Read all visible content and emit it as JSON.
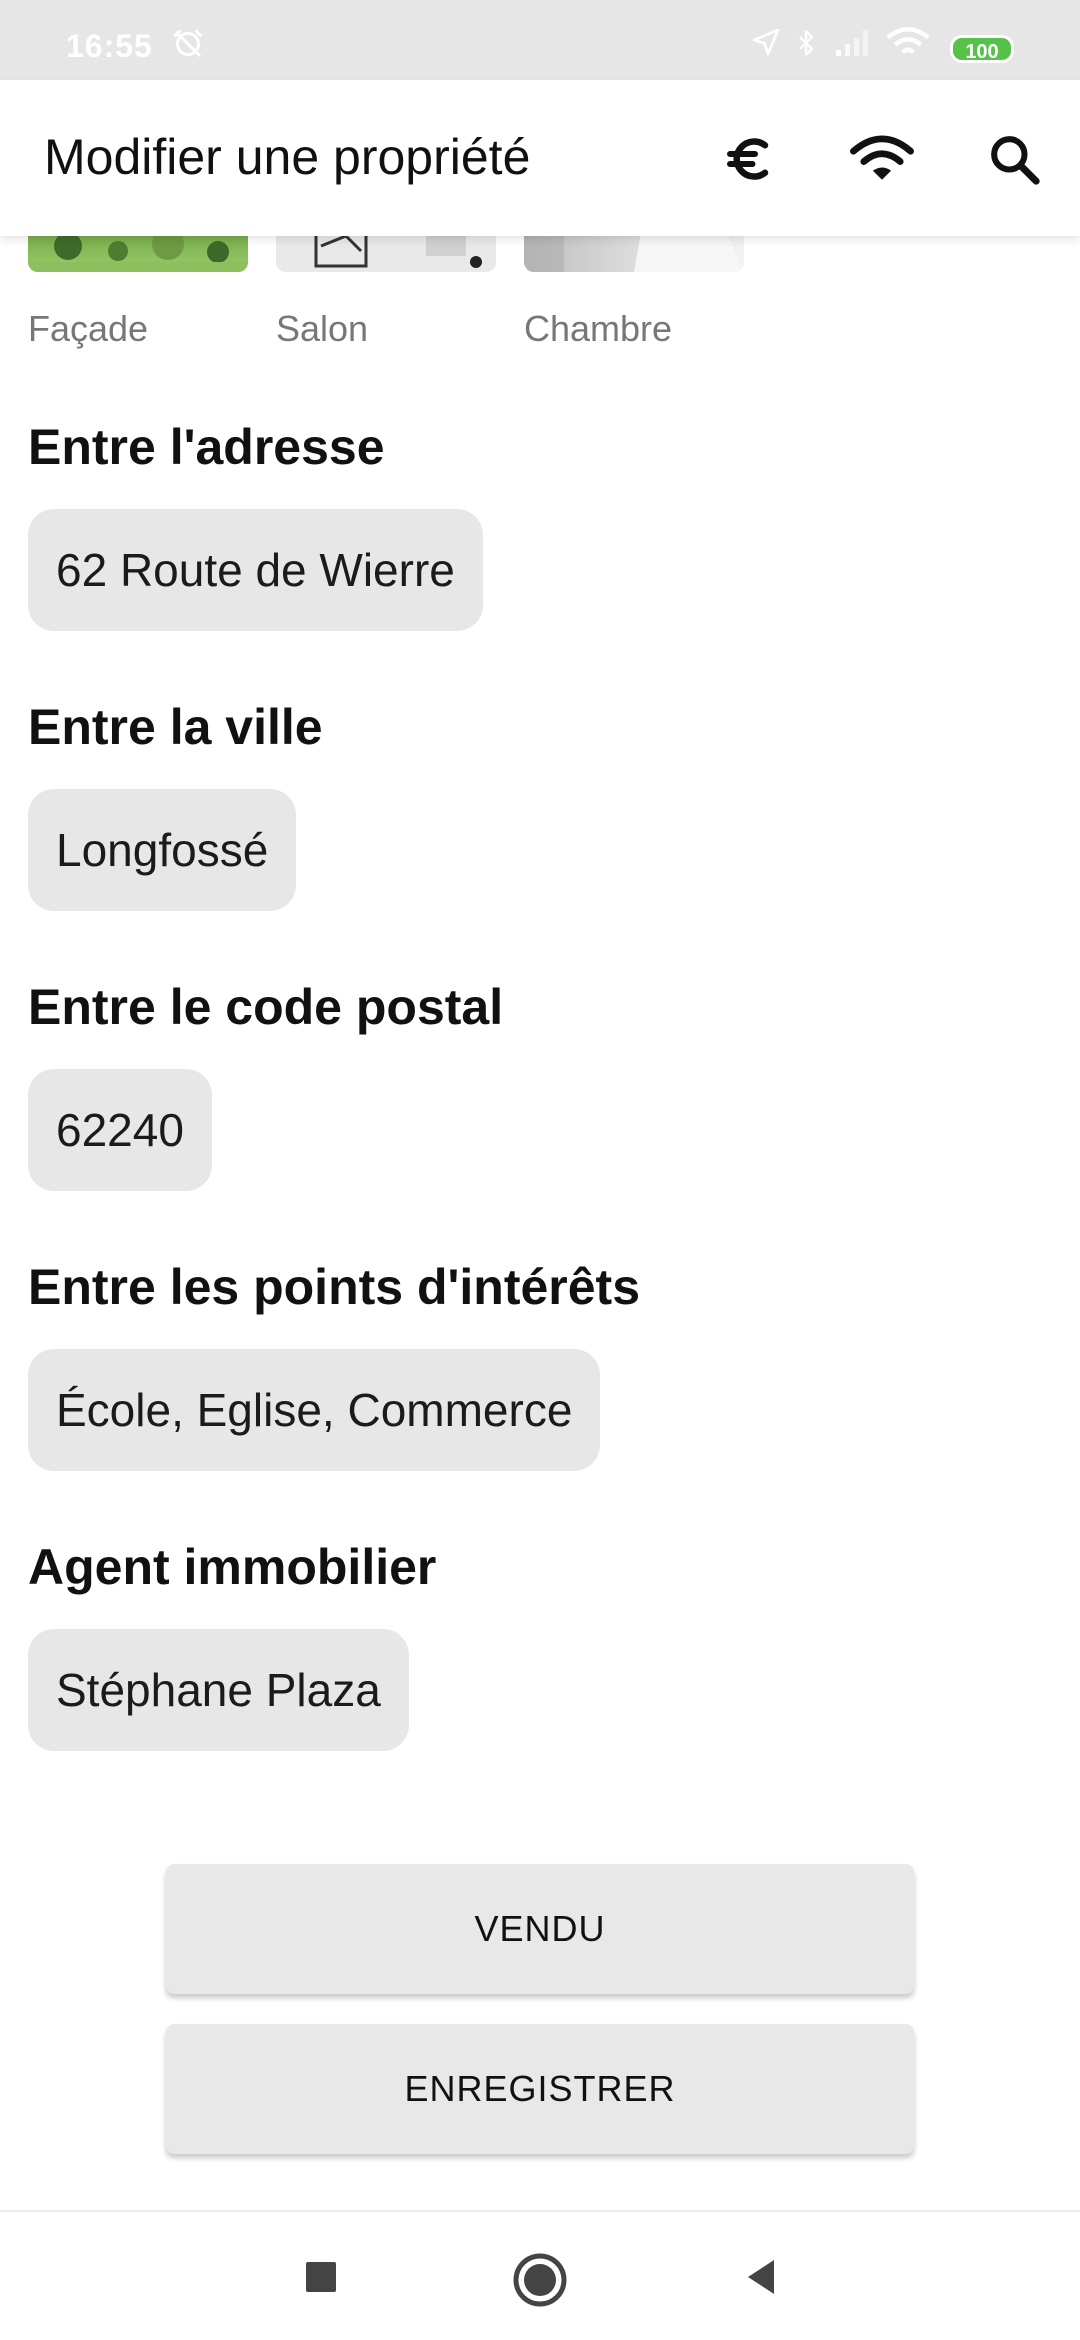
{
  "status_bar": {
    "time": "16:55",
    "battery": "100"
  },
  "app_bar": {
    "title": "Modifier une propriété",
    "icons": [
      "euro-icon",
      "wifi-icon",
      "search-icon"
    ]
  },
  "photos": [
    {
      "caption": "Façade"
    },
    {
      "caption": "Salon"
    },
    {
      "caption": "Chambre"
    }
  ],
  "fields": {
    "address": {
      "label": "Entre l'adresse",
      "value": "62 Route de Wierre"
    },
    "city": {
      "label": "Entre la ville",
      "value": "Longfossé"
    },
    "postal_code": {
      "label": "Entre le code postal",
      "value": "62240"
    },
    "points_of_interest": {
      "label": "Entre les points d'intérêts",
      "value": "École, Eglise, Commerce"
    },
    "agent": {
      "label": "Agent immobilier",
      "value": "Stéphane Plaza"
    }
  },
  "actions": {
    "sold_label": "VENDU",
    "save_label": "ENREGISTRER"
  },
  "colors": {
    "chip_background": "#e7e7e7",
    "button_background": "#e8e8e8",
    "battery_green": "#57c24a"
  }
}
